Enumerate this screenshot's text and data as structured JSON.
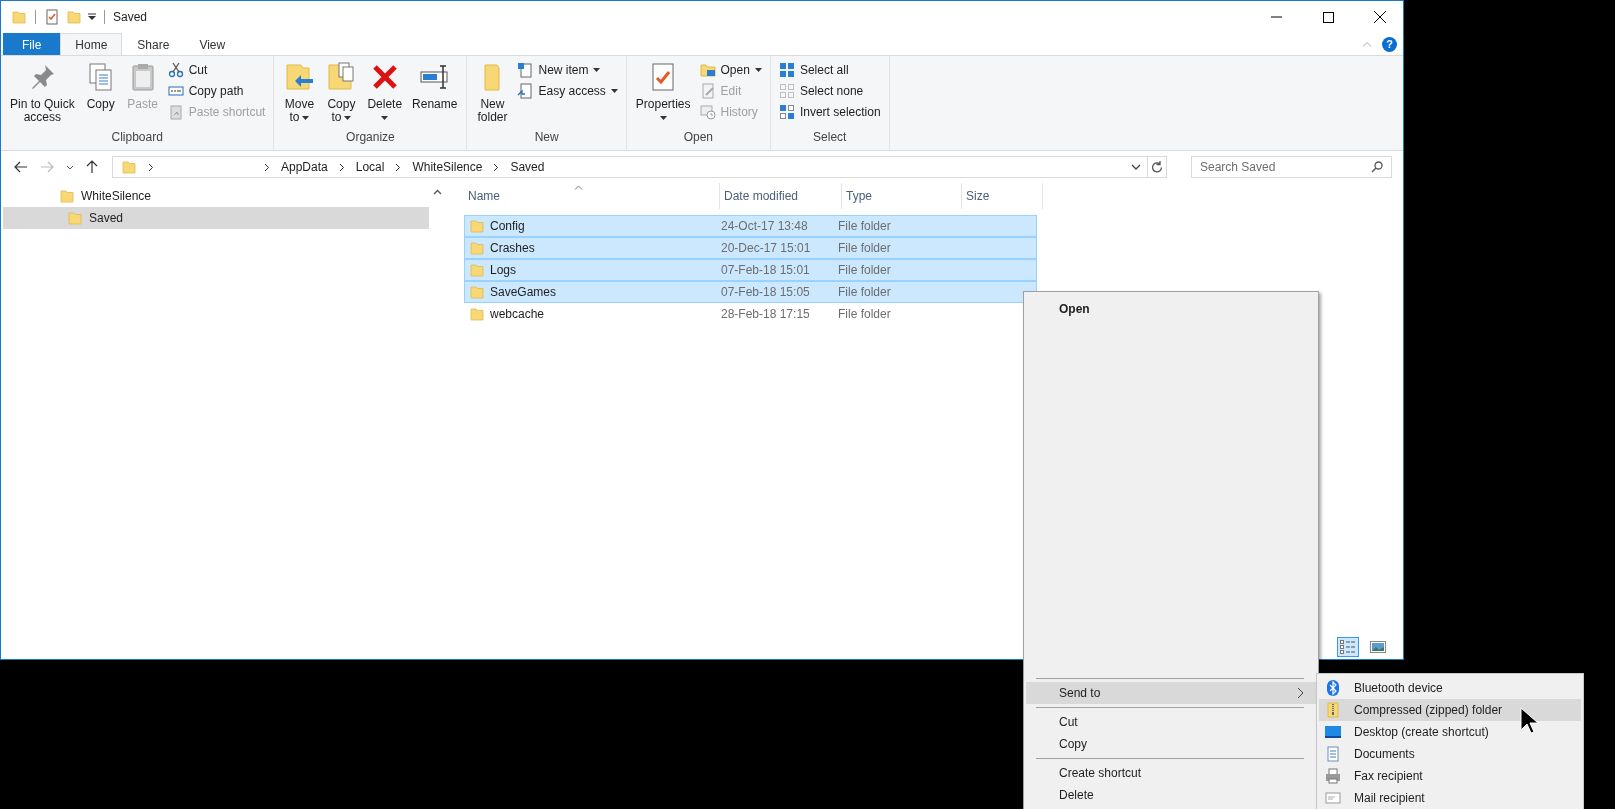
{
  "window": {
    "title": "Saved",
    "help": "?"
  },
  "tabs": [
    {
      "label": "File",
      "kind": "file",
      "selected": false
    },
    {
      "label": "Home",
      "kind": "tab",
      "selected": true
    },
    {
      "label": "Share",
      "kind": "tab",
      "selected": false
    },
    {
      "label": "View",
      "kind": "tab",
      "selected": false
    }
  ],
  "ribbon": [
    {
      "label": "Clipboard",
      "items": [
        {
          "kind": "large",
          "lines": [
            "Pin to Quick",
            "access"
          ],
          "disabled": false,
          "dropdown": false
        },
        {
          "kind": "large",
          "lines": [
            "Copy"
          ],
          "disabled": false,
          "dropdown": false
        },
        {
          "kind": "large",
          "lines": [
            "Paste"
          ],
          "disabled": true,
          "dropdown": false
        },
        {
          "kind": "small",
          "lines": [
            "Cut"
          ],
          "disabled": false,
          "dropdown": false
        },
        {
          "kind": "small",
          "lines": [
            "Copy path"
          ],
          "disabled": false,
          "dropdown": false
        },
        {
          "kind": "small",
          "lines": [
            "Paste shortcut"
          ],
          "disabled": true,
          "dropdown": false
        }
      ]
    },
    {
      "label": "Organize",
      "items": [
        {
          "kind": "large",
          "lines": [
            "Move",
            "to"
          ],
          "disabled": false,
          "dropdown": true
        },
        {
          "kind": "large",
          "lines": [
            "Copy",
            "to"
          ],
          "disabled": false,
          "dropdown": true
        },
        {
          "kind": "large",
          "lines": [
            "Delete"
          ],
          "disabled": false,
          "dropdown": true
        },
        {
          "kind": "large",
          "lines": [
            "Rename"
          ],
          "disabled": false,
          "dropdown": false
        }
      ]
    },
    {
      "label": "New",
      "items": [
        {
          "kind": "large",
          "lines": [
            "New",
            "folder"
          ],
          "disabled": false,
          "dropdown": false
        },
        {
          "kind": "small",
          "lines": [
            "New item"
          ],
          "disabled": false,
          "dropdown": true
        },
        {
          "kind": "small",
          "lines": [
            "Easy access"
          ],
          "disabled": false,
          "dropdown": true
        }
      ]
    },
    {
      "label": "Open",
      "items": [
        {
          "kind": "large",
          "lines": [
            "Properties"
          ],
          "disabled": false,
          "dropdown": true
        },
        {
          "kind": "small",
          "lines": [
            "Open"
          ],
          "disabled": false,
          "dropdown": true
        },
        {
          "kind": "small",
          "lines": [
            "Edit"
          ],
          "disabled": true,
          "dropdown": false
        },
        {
          "kind": "small",
          "lines": [
            "History"
          ],
          "disabled": true,
          "dropdown": false
        }
      ]
    },
    {
      "label": "Select",
      "items": [
        {
          "kind": "small",
          "lines": [
            "Select all"
          ],
          "disabled": false,
          "dropdown": false
        },
        {
          "kind": "small",
          "lines": [
            "Select none"
          ],
          "disabled": false,
          "dropdown": false
        },
        {
          "kind": "small",
          "lines": [
            "Invert selection"
          ],
          "disabled": false,
          "dropdown": false
        }
      ]
    }
  ],
  "address": {
    "path": [
      "AppData",
      "Local",
      "WhiteSilence",
      "Saved"
    ]
  },
  "search": {
    "placeholder": "Search Saved"
  },
  "nav_tree": [
    {
      "label": "WhiteSilence",
      "selected": false,
      "children": [
        {
          "label": "Saved",
          "selected": true
        }
      ]
    }
  ],
  "columns": [
    "Name",
    "Date modified",
    "Type",
    "Size"
  ],
  "files": [
    {
      "name": "Config",
      "date": "24-Oct-17 13:48",
      "type": "File folder",
      "selected": true
    },
    {
      "name": "Crashes",
      "date": "20-Dec-17 15:01",
      "type": "File folder",
      "selected": true
    },
    {
      "name": "Logs",
      "date": "07-Feb-18 15:01",
      "type": "File folder",
      "selected": true
    },
    {
      "name": "SaveGames",
      "date": "07-Feb-18 15:05",
      "type": "File folder",
      "selected": true
    },
    {
      "name": "webcache",
      "date": "28-Feb-18 17:15",
      "type": "File folder",
      "selected": false
    }
  ],
  "view_modes": [
    {
      "kind": "details",
      "selected": true
    },
    {
      "kind": "large-icons",
      "selected": false
    }
  ],
  "context_menu": {
    "items": [
      {
        "kind": "item",
        "label": "Open",
        "default": true,
        "selected": false
      },
      {
        "kind": "separator"
      },
      {
        "kind": "submenu",
        "label": "Send to",
        "default": false,
        "selected": true
      },
      {
        "kind": "separator"
      },
      {
        "kind": "item",
        "label": "Cut",
        "default": false,
        "selected": false
      },
      {
        "kind": "item",
        "label": "Copy",
        "default": false,
        "selected": false
      },
      {
        "kind": "separator"
      },
      {
        "kind": "item",
        "label": "Create shortcut",
        "default": false,
        "selected": false
      },
      {
        "kind": "item",
        "label": "Delete",
        "default": false,
        "selected": false
      }
    ]
  },
  "send_to_menu": {
    "items": [
      {
        "label": "Bluetooth device",
        "selected": false
      },
      {
        "label": "Compressed (zipped) folder",
        "selected": true
      },
      {
        "label": "Desktop (create shortcut)",
        "selected": false
      },
      {
        "label": "Documents",
        "selected": false
      },
      {
        "label": "Fax recipient",
        "selected": false
      },
      {
        "label": "Mail recipient",
        "selected": false
      }
    ]
  }
}
